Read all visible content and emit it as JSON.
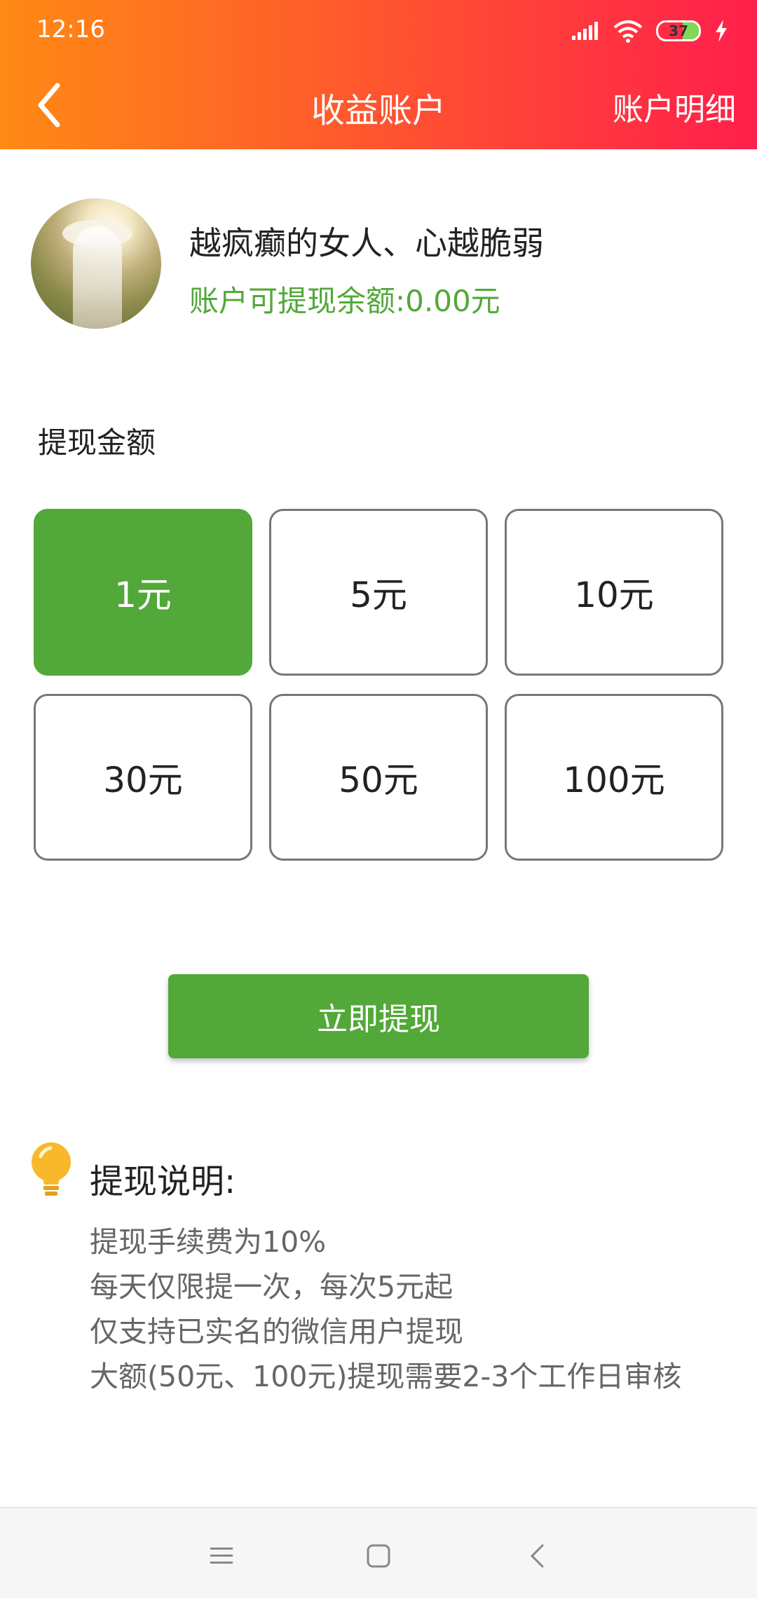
{
  "status_bar": {
    "time": "12:16",
    "battery": "37"
  },
  "header": {
    "title": "收益账户",
    "right_link": "账户明细"
  },
  "profile": {
    "username": "越疯癫的女人、心越脆弱",
    "balance": "账户可提现余额:0.00元"
  },
  "withdraw": {
    "section_label": "提现金额",
    "options": [
      "1元",
      "5元",
      "10元",
      "30元",
      "50元",
      "100元"
    ],
    "selected": "1元",
    "button_label": "立即提现"
  },
  "notes": {
    "title": "提现说明:",
    "items": [
      "提现手续费为10%",
      "每天仅限提一次，每次5元起",
      "仅支持已实名的微信用户提现",
      "大额(50元、100元)提现需要2-3个工作日审核"
    ]
  },
  "colors": {
    "accent_green": "#52a838",
    "header_start": "#ff8a14",
    "header_end": "#ff1f4b"
  }
}
